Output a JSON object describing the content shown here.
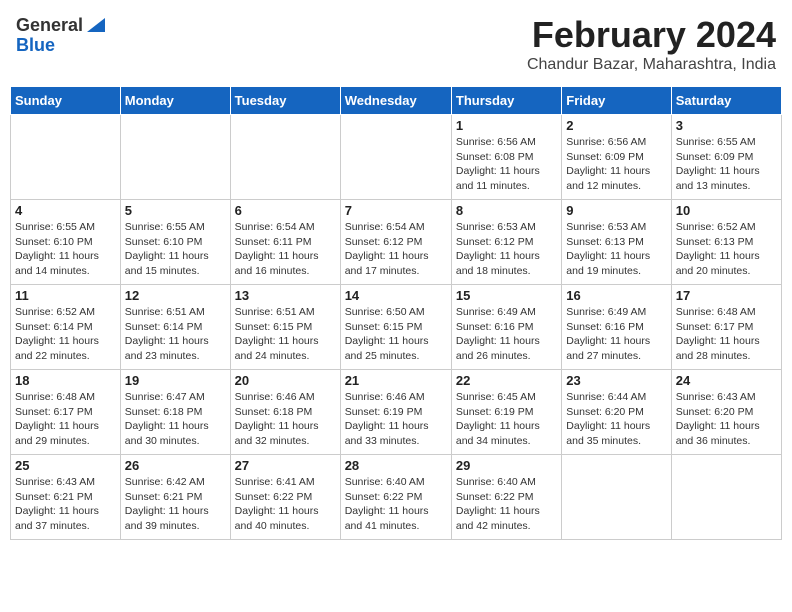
{
  "logo": {
    "general": "General",
    "blue": "Blue"
  },
  "title": {
    "month": "February 2024",
    "location": "Chandur Bazar, Maharashtra, India"
  },
  "weekdays": [
    "Sunday",
    "Monday",
    "Tuesday",
    "Wednesday",
    "Thursday",
    "Friday",
    "Saturday"
  ],
  "weeks": [
    [
      {
        "day": "",
        "info": ""
      },
      {
        "day": "",
        "info": ""
      },
      {
        "day": "",
        "info": ""
      },
      {
        "day": "",
        "info": ""
      },
      {
        "day": "1",
        "info": "Sunrise: 6:56 AM\nSunset: 6:08 PM\nDaylight: 11 hours\nand 11 minutes."
      },
      {
        "day": "2",
        "info": "Sunrise: 6:56 AM\nSunset: 6:09 PM\nDaylight: 11 hours\nand 12 minutes."
      },
      {
        "day": "3",
        "info": "Sunrise: 6:55 AM\nSunset: 6:09 PM\nDaylight: 11 hours\nand 13 minutes."
      }
    ],
    [
      {
        "day": "4",
        "info": "Sunrise: 6:55 AM\nSunset: 6:10 PM\nDaylight: 11 hours\nand 14 minutes."
      },
      {
        "day": "5",
        "info": "Sunrise: 6:55 AM\nSunset: 6:10 PM\nDaylight: 11 hours\nand 15 minutes."
      },
      {
        "day": "6",
        "info": "Sunrise: 6:54 AM\nSunset: 6:11 PM\nDaylight: 11 hours\nand 16 minutes."
      },
      {
        "day": "7",
        "info": "Sunrise: 6:54 AM\nSunset: 6:12 PM\nDaylight: 11 hours\nand 17 minutes."
      },
      {
        "day": "8",
        "info": "Sunrise: 6:53 AM\nSunset: 6:12 PM\nDaylight: 11 hours\nand 18 minutes."
      },
      {
        "day": "9",
        "info": "Sunrise: 6:53 AM\nSunset: 6:13 PM\nDaylight: 11 hours\nand 19 minutes."
      },
      {
        "day": "10",
        "info": "Sunrise: 6:52 AM\nSunset: 6:13 PM\nDaylight: 11 hours\nand 20 minutes."
      }
    ],
    [
      {
        "day": "11",
        "info": "Sunrise: 6:52 AM\nSunset: 6:14 PM\nDaylight: 11 hours\nand 22 minutes."
      },
      {
        "day": "12",
        "info": "Sunrise: 6:51 AM\nSunset: 6:14 PM\nDaylight: 11 hours\nand 23 minutes."
      },
      {
        "day": "13",
        "info": "Sunrise: 6:51 AM\nSunset: 6:15 PM\nDaylight: 11 hours\nand 24 minutes."
      },
      {
        "day": "14",
        "info": "Sunrise: 6:50 AM\nSunset: 6:15 PM\nDaylight: 11 hours\nand 25 minutes."
      },
      {
        "day": "15",
        "info": "Sunrise: 6:49 AM\nSunset: 6:16 PM\nDaylight: 11 hours\nand 26 minutes."
      },
      {
        "day": "16",
        "info": "Sunrise: 6:49 AM\nSunset: 6:16 PM\nDaylight: 11 hours\nand 27 minutes."
      },
      {
        "day": "17",
        "info": "Sunrise: 6:48 AM\nSunset: 6:17 PM\nDaylight: 11 hours\nand 28 minutes."
      }
    ],
    [
      {
        "day": "18",
        "info": "Sunrise: 6:48 AM\nSunset: 6:17 PM\nDaylight: 11 hours\nand 29 minutes."
      },
      {
        "day": "19",
        "info": "Sunrise: 6:47 AM\nSunset: 6:18 PM\nDaylight: 11 hours\nand 30 minutes."
      },
      {
        "day": "20",
        "info": "Sunrise: 6:46 AM\nSunset: 6:18 PM\nDaylight: 11 hours\nand 32 minutes."
      },
      {
        "day": "21",
        "info": "Sunrise: 6:46 AM\nSunset: 6:19 PM\nDaylight: 11 hours\nand 33 minutes."
      },
      {
        "day": "22",
        "info": "Sunrise: 6:45 AM\nSunset: 6:19 PM\nDaylight: 11 hours\nand 34 minutes."
      },
      {
        "day": "23",
        "info": "Sunrise: 6:44 AM\nSunset: 6:20 PM\nDaylight: 11 hours\nand 35 minutes."
      },
      {
        "day": "24",
        "info": "Sunrise: 6:43 AM\nSunset: 6:20 PM\nDaylight: 11 hours\nand 36 minutes."
      }
    ],
    [
      {
        "day": "25",
        "info": "Sunrise: 6:43 AM\nSunset: 6:21 PM\nDaylight: 11 hours\nand 37 minutes."
      },
      {
        "day": "26",
        "info": "Sunrise: 6:42 AM\nSunset: 6:21 PM\nDaylight: 11 hours\nand 39 minutes."
      },
      {
        "day": "27",
        "info": "Sunrise: 6:41 AM\nSunset: 6:22 PM\nDaylight: 11 hours\nand 40 minutes."
      },
      {
        "day": "28",
        "info": "Sunrise: 6:40 AM\nSunset: 6:22 PM\nDaylight: 11 hours\nand 41 minutes."
      },
      {
        "day": "29",
        "info": "Sunrise: 6:40 AM\nSunset: 6:22 PM\nDaylight: 11 hours\nand 42 minutes."
      },
      {
        "day": "",
        "info": ""
      },
      {
        "day": "",
        "info": ""
      }
    ]
  ]
}
